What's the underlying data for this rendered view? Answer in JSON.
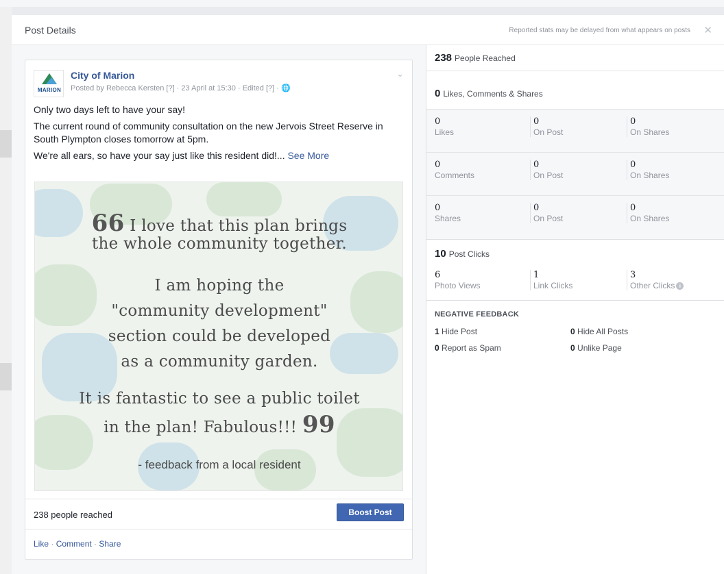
{
  "dialog": {
    "title": "Post Details",
    "note": "Reported stats may be delayed from what appears on posts",
    "close_glyph": "✕"
  },
  "post": {
    "page_name": "City of Marion",
    "logo_text": "MARION",
    "meta": "Posted by Rebecca Kersten [?] · 23 April at 15:30 · Edited [?] · 🌐",
    "text_lines": [
      "Only two days left to have your say!",
      "The current round of community consultation on the new Jervois Street Reserve in South Plympton closes tomorrow at 5pm.",
      "We're all ears, so have your say just like this resident did!..."
    ],
    "see_more": "See More",
    "image": {
      "open_quote": "66",
      "close_quote": "99",
      "lines": [
        "I love that this plan brings",
        "the whole community together.",
        "I am hoping the",
        "\"community development\"",
        "section could be developed",
        "as a community garden.",
        "It is fantastic to see a public toilet",
        "in the plan! Fabulous!!!"
      ],
      "attribution": "- feedback from a local resident"
    },
    "reach_text": "238 people reached",
    "boost_label": "Boost Post",
    "actions": {
      "like": "Like",
      "comment": "Comment",
      "share": "Share",
      "separator": " · "
    }
  },
  "stats": {
    "people_reached": {
      "value": "238",
      "label": "People Reached"
    },
    "engagement": {
      "value": "0",
      "label": "Likes, Comments & Shares"
    },
    "rows": [
      {
        "total": "0",
        "total_label": "Likes",
        "on_post": "0",
        "on_post_label": "On Post",
        "on_shares": "0",
        "on_shares_label": "On Shares"
      },
      {
        "total": "0",
        "total_label": "Comments",
        "on_post": "0",
        "on_post_label": "On Post",
        "on_shares": "0",
        "on_shares_label": "On Shares"
      },
      {
        "total": "0",
        "total_label": "Shares",
        "on_post": "0",
        "on_post_label": "On Post",
        "on_shares": "0",
        "on_shares_label": "On Shares"
      }
    ],
    "post_clicks": {
      "value": "10",
      "label": "Post Clicks"
    },
    "click_breakdown": [
      {
        "value": "6",
        "label": "Photo Views"
      },
      {
        "value": "1",
        "label": "Link Clicks"
      },
      {
        "value": "3",
        "label": "Other Clicks"
      }
    ],
    "negative": {
      "title": "NEGATIVE FEEDBACK",
      "items": [
        {
          "value": "1",
          "label": "Hide Post"
        },
        {
          "value": "0",
          "label": "Hide All Posts"
        },
        {
          "value": "0",
          "label": "Report as Spam"
        },
        {
          "value": "0",
          "label": "Unlike Page"
        }
      ]
    }
  },
  "colors": {
    "link": "#365899",
    "boost": "#4267b2",
    "muted": "#90949c"
  }
}
